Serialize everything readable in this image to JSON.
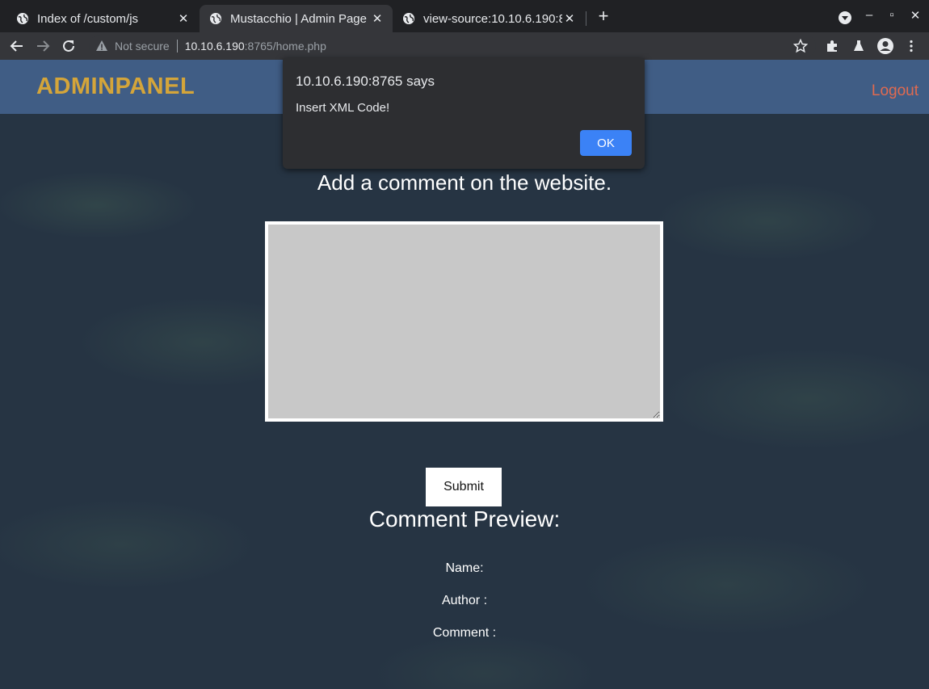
{
  "browser": {
    "tabs": [
      {
        "title": "Index of /custom/js",
        "active": false
      },
      {
        "title": "Mustacchio | Admin Page",
        "active": true
      },
      {
        "title": "view-source:10.10.6.190:8",
        "active": false
      }
    ],
    "new_tab_label": "+",
    "close_glyph": "✕",
    "window_controls": {
      "minimize": "–",
      "maximize": "▫",
      "close": "✕"
    },
    "address_bar": {
      "security_label": "Not secure",
      "url_host": "10.10.6.190",
      "url_rest": ":8765/home.php"
    },
    "icons": [
      "back-icon",
      "forward-icon",
      "reload-icon",
      "warning-icon",
      "star-icon",
      "extensions-icon",
      "labs-icon",
      "profile-icon",
      "menu-icon",
      "globe-icon",
      "tab-search-icon"
    ]
  },
  "page": {
    "brand": "ADMINPANEL",
    "logout_label": "Logout",
    "heading": "Add a comment on the website.",
    "textarea_value": "",
    "submit_label": "Submit",
    "preview_title": "Comment Preview:",
    "preview_fields": {
      "name_label": "Name:",
      "author_label": "Author :",
      "comment_label": "Comment :"
    },
    "colors": {
      "navbar": "#405d85",
      "brand": "#d4a53a",
      "logout": "#e06a50",
      "background": "#263443"
    }
  },
  "dialog": {
    "origin": "10.10.6.190:8765 says",
    "message": "Insert XML Code!",
    "ok_label": "OK",
    "ok_color": "#3b82f6"
  }
}
